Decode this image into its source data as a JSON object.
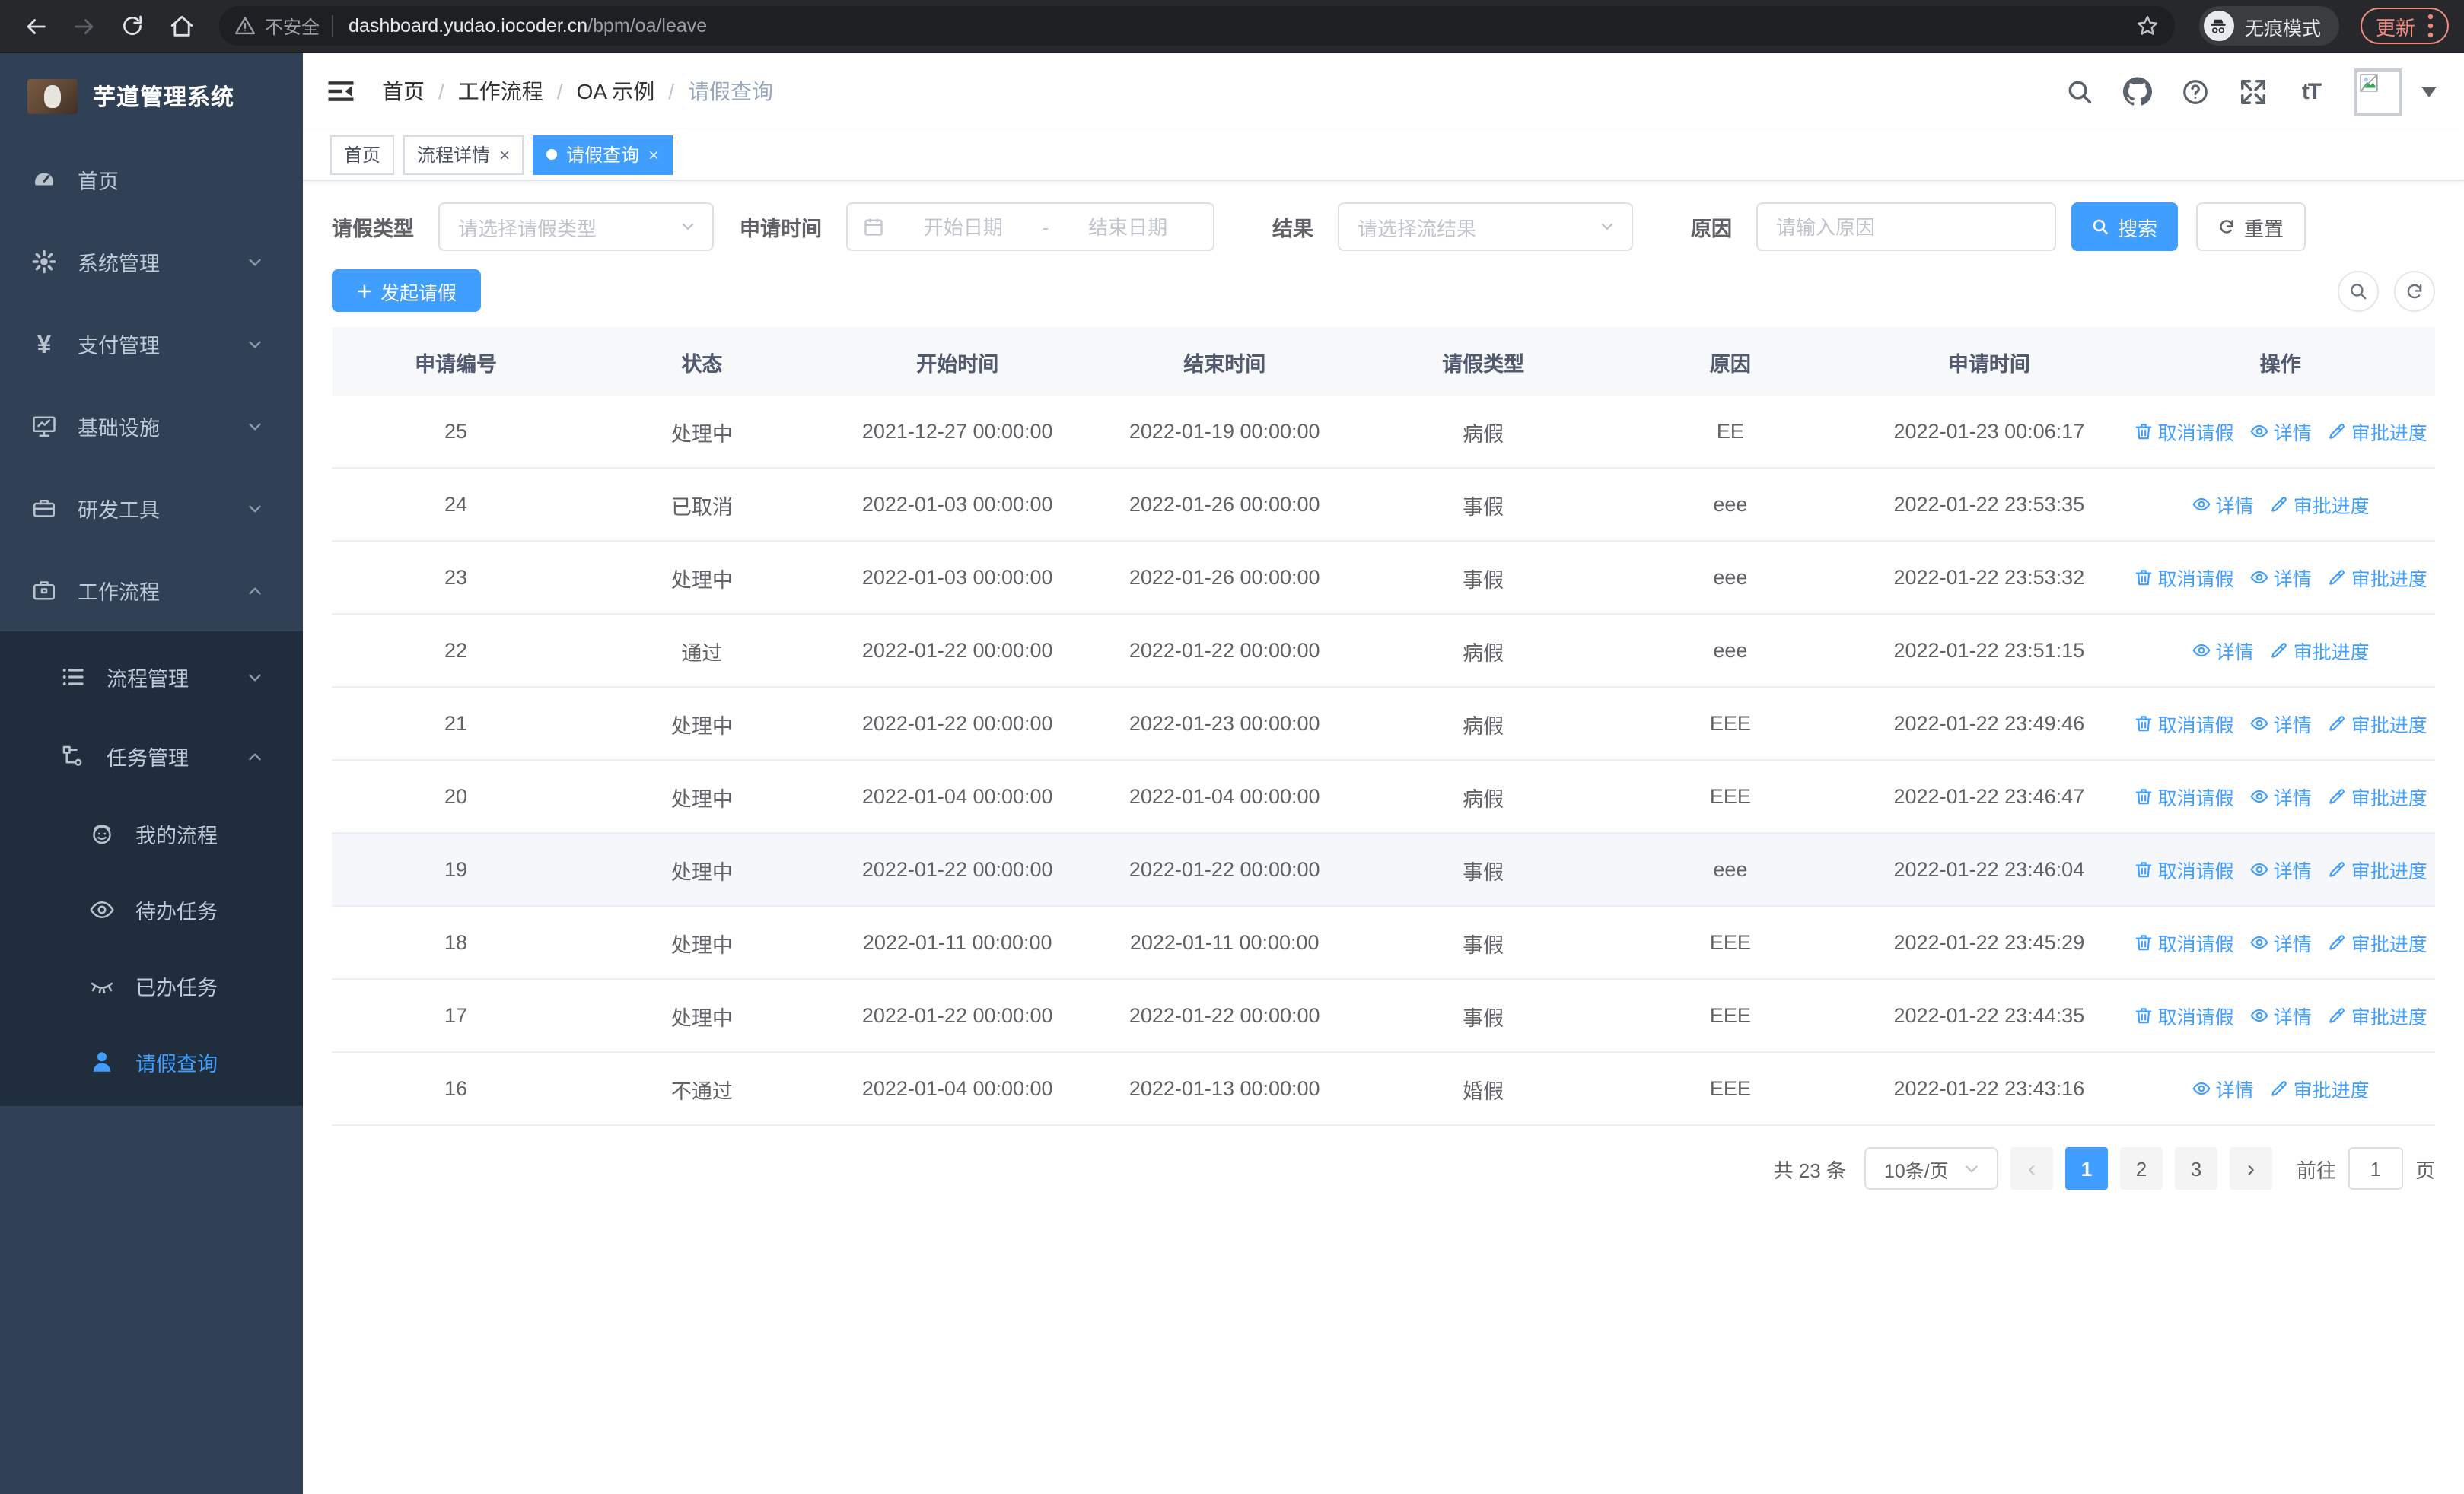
{
  "browser": {
    "security_label": "不安全",
    "url_host": "dashboard.yudao.iocoder.cn",
    "url_path": "/bpm/oa/leave",
    "incognito_label": "无痕模式",
    "update_label": "更新"
  },
  "sidebar": {
    "title": "芋道管理系统",
    "menu": [
      {
        "icon": "dashboard-icon",
        "label": "首页"
      },
      {
        "icon": "gear-icon",
        "label": "系统管理",
        "chevron": "down"
      },
      {
        "icon": "yen-icon",
        "label": "支付管理",
        "chevron": "down"
      },
      {
        "icon": "monitor-icon",
        "label": "基础设施",
        "chevron": "down"
      },
      {
        "icon": "toolbox-icon",
        "label": "研发工具",
        "chevron": "down"
      },
      {
        "icon": "briefcase-icon",
        "label": "工作流程",
        "chevron": "up",
        "expanded": true,
        "children": [
          {
            "icon": "list-icon",
            "label": "流程管理",
            "chevron": "down"
          },
          {
            "icon": "tree-icon",
            "label": "任务管理",
            "chevron": "up",
            "expanded": true,
            "children": [
              {
                "icon": "robot-icon",
                "label": "我的流程"
              },
              {
                "icon": "eye-icon",
                "label": "待办任务"
              },
              {
                "icon": "eye-closed-icon",
                "label": "已办任务"
              },
              {
                "icon": "user-icon",
                "label": "请假查询",
                "active": true
              }
            ]
          }
        ]
      }
    ]
  },
  "header": {
    "breadcrumb": [
      "首页",
      "工作流程",
      "OA 示例",
      "请假查询"
    ]
  },
  "tabs": [
    {
      "label": "首页",
      "closable": false,
      "active": false
    },
    {
      "label": "流程详情",
      "closable": true,
      "active": false
    },
    {
      "label": "请假查询",
      "closable": true,
      "active": true
    }
  ],
  "filters": {
    "type_label": "请假类型",
    "type_placeholder": "请选择请假类型",
    "time_label": "申请时间",
    "start_placeholder": "开始日期",
    "range_separator": "-",
    "end_placeholder": "结束日期",
    "result_label": "结果",
    "result_placeholder": "请选择流结果",
    "reason_label": "原因",
    "reason_placeholder": "请输入原因",
    "search_label": "搜索",
    "reset_label": "重置"
  },
  "toolbar": {
    "create_label": "发起请假"
  },
  "table": {
    "columns": [
      "申请编号",
      "状态",
      "开始时间",
      "结束时间",
      "请假类型",
      "原因",
      "申请时间",
      "操作"
    ],
    "action_labels": {
      "cancel": "取消请假",
      "detail": "详情",
      "progress": "审批进度"
    },
    "rows": [
      {
        "id": "25",
        "status": "处理中",
        "start": "2021-12-27 00:00:00",
        "end": "2022-01-19 00:00:00",
        "type": "病假",
        "reason": "EE",
        "apply_time": "2022-01-23 00:06:17",
        "actions": [
          "cancel",
          "detail",
          "progress"
        ],
        "highlight": false
      },
      {
        "id": "24",
        "status": "已取消",
        "start": "2022-01-03 00:00:00",
        "end": "2022-01-26 00:00:00",
        "type": "事假",
        "reason": "eee",
        "apply_time": "2022-01-22 23:53:35",
        "actions": [
          "detail",
          "progress"
        ],
        "highlight": false
      },
      {
        "id": "23",
        "status": "处理中",
        "start": "2022-01-03 00:00:00",
        "end": "2022-01-26 00:00:00",
        "type": "事假",
        "reason": "eee",
        "apply_time": "2022-01-22 23:53:32",
        "actions": [
          "cancel",
          "detail",
          "progress"
        ],
        "highlight": false
      },
      {
        "id": "22",
        "status": "通过",
        "start": "2022-01-22 00:00:00",
        "end": "2022-01-22 00:00:00",
        "type": "病假",
        "reason": "eee",
        "apply_time": "2022-01-22 23:51:15",
        "actions": [
          "detail",
          "progress"
        ],
        "highlight": false
      },
      {
        "id": "21",
        "status": "处理中",
        "start": "2022-01-22 00:00:00",
        "end": "2022-01-23 00:00:00",
        "type": "病假",
        "reason": "EEE",
        "apply_time": "2022-01-22 23:49:46",
        "actions": [
          "cancel",
          "detail",
          "progress"
        ],
        "highlight": false
      },
      {
        "id": "20",
        "status": "处理中",
        "start": "2022-01-04 00:00:00",
        "end": "2022-01-04 00:00:00",
        "type": "病假",
        "reason": "EEE",
        "apply_time": "2022-01-22 23:46:47",
        "actions": [
          "cancel",
          "detail",
          "progress"
        ],
        "highlight": false
      },
      {
        "id": "19",
        "status": "处理中",
        "start": "2022-01-22 00:00:00",
        "end": "2022-01-22 00:00:00",
        "type": "事假",
        "reason": "eee",
        "apply_time": "2022-01-22 23:46:04",
        "actions": [
          "cancel",
          "detail",
          "progress"
        ],
        "highlight": true
      },
      {
        "id": "18",
        "status": "处理中",
        "start": "2022-01-11 00:00:00",
        "end": "2022-01-11 00:00:00",
        "type": "事假",
        "reason": "EEE",
        "apply_time": "2022-01-22 23:45:29",
        "actions": [
          "cancel",
          "detail",
          "progress"
        ],
        "highlight": false
      },
      {
        "id": "17",
        "status": "处理中",
        "start": "2022-01-22 00:00:00",
        "end": "2022-01-22 00:00:00",
        "type": "事假",
        "reason": "EEE",
        "apply_time": "2022-01-22 23:44:35",
        "actions": [
          "cancel",
          "detail",
          "progress"
        ],
        "highlight": false
      },
      {
        "id": "16",
        "status": "不通过",
        "start": "2022-01-04 00:00:00",
        "end": "2022-01-13 00:00:00",
        "type": "婚假",
        "reason": "EEE",
        "apply_time": "2022-01-22 23:43:16",
        "actions": [
          "detail",
          "progress"
        ],
        "highlight": false
      }
    ]
  },
  "pagination": {
    "total_text": "共 23 条",
    "page_size": "10条/页",
    "pages": [
      "1",
      "2",
      "3"
    ],
    "active_page": "1",
    "goto_label": "前往",
    "goto_value": "1",
    "goto_suffix": "页"
  },
  "colors": {
    "accent": "#409eff",
    "sidebar_bg": "#304156",
    "submenu_bg": "#1f2d3d",
    "sidebar_text": "#bfcbd9",
    "update_button": "#ee8a80",
    "table_border": "#ebeef5"
  }
}
